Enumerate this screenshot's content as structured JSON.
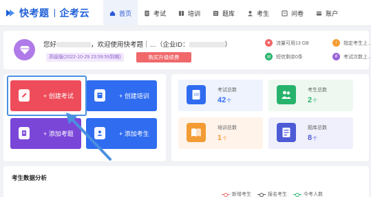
{
  "brand": {
    "name_primary": "快考题",
    "name_secondary": "企考云",
    "accent": "#1f5fd6"
  },
  "nav": [
    {
      "label": "首页",
      "icon": "home-icon",
      "active": true
    },
    {
      "label": "考试",
      "icon": "exam-icon"
    },
    {
      "label": "培训",
      "icon": "training-icon"
    },
    {
      "label": "题库",
      "icon": "question-bank-icon"
    },
    {
      "label": "考生",
      "icon": "user-icon"
    },
    {
      "label": "问卷",
      "icon": "survey-icon"
    },
    {
      "label": "账户",
      "icon": "account-icon"
    }
  ],
  "welcome": {
    "greeting_prefix": "您好",
    "greeting_main": "，欢迎使用快考题｜…",
    "company_label": "（企业ID：",
    "company_suffix": "）",
    "vip_label": "高级版(2022-10-29 23:59:59到期)",
    "renew_button": "购买升级续费"
  },
  "quotas": [
    {
      "label": "流量可用13 GB",
      "icon": "traffic-icon",
      "color": "#f0686a"
    },
    {
      "label": "短信剩余0条",
      "icon": "sms-icon",
      "color": "#27b36b"
    },
    {
      "label": "指定考生上…",
      "icon": "upload-icon",
      "color": "#f39c33"
    },
    {
      "label": "考试次数上…",
      "icon": "count-icon",
      "color": "#9a63d8"
    }
  ],
  "actions": [
    {
      "label": "+ 创建考试",
      "icon": "edit-icon",
      "color": "#ee4c5a"
    },
    {
      "label": "+ 创建培训",
      "icon": "book-icon",
      "color": "#2f6cf0"
    },
    {
      "label": "+ 添加考题",
      "icon": "document-icon",
      "color": "#7a46d8"
    },
    {
      "label": "+ 添加考生",
      "icon": "user-add-icon",
      "color": "#2f6cf0"
    }
  ],
  "stats": [
    {
      "label": "考试总数",
      "value": "42",
      "unit": "个",
      "icon": "exam-total-icon",
      "color": "#2f6cf0",
      "bg": "#eef3fd"
    },
    {
      "label": "考生总数",
      "value": "2",
      "unit": "个",
      "icon": "people-icon",
      "color": "#27b36b",
      "bg": "#eef8f1"
    },
    {
      "label": "培训总数",
      "value": "1",
      "unit": "个",
      "icon": "training-total-icon",
      "color": "#f39c33",
      "bg": "#fff3ea"
    },
    {
      "label": "题库总数",
      "value": "8",
      "unit": "个",
      "icon": "bank-total-icon",
      "color": "#4e5bd6",
      "bg": "#eff0fb"
    }
  ],
  "analysis": {
    "title": "考生数据分析",
    "legend": [
      {
        "label": "新增考生",
        "color": "#f0686a"
      },
      {
        "label": "报名考生",
        "color": "#555555"
      },
      {
        "label": "今考人数",
        "color": "#27b36b"
      }
    ]
  }
}
